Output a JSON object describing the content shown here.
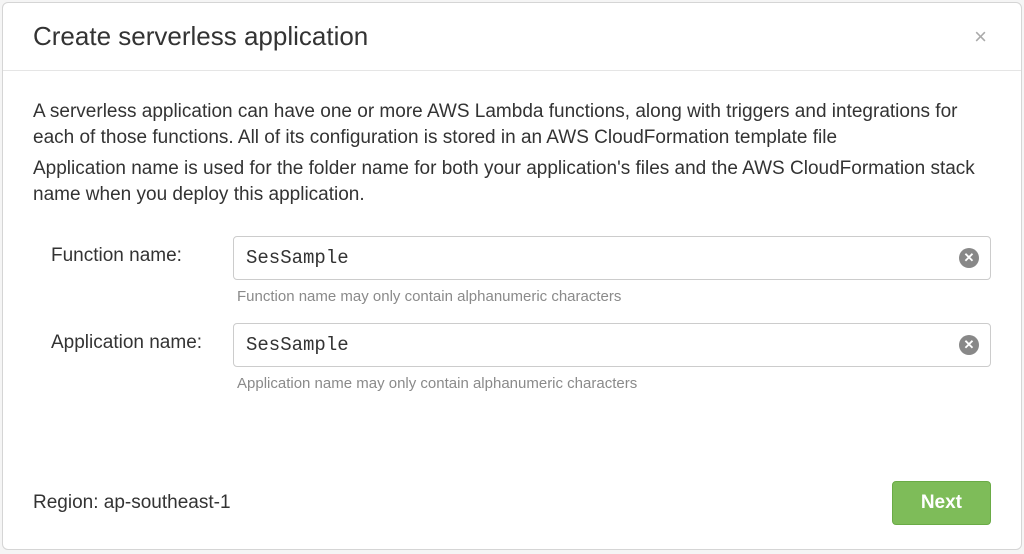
{
  "header": {
    "title": "Create serverless application"
  },
  "body": {
    "description1": "A serverless application can have one or more AWS Lambda functions, along with triggers and integrations for each of those functions. All of its configuration is stored in an AWS CloudFormation template file",
    "description2": "Application name is used for the folder name for both your application's files and the AWS CloudFormation stack name when you deploy this application.",
    "function_name": {
      "label": "Function name:",
      "value": "SesSample",
      "hint": "Function name may only contain alphanumeric characters"
    },
    "application_name": {
      "label": "Application name:",
      "value": "SesSample",
      "hint": "Application name may only contain alphanumeric characters"
    }
  },
  "footer": {
    "region_prefix": "Region: ",
    "region_value": "ap-southeast-1",
    "next_label": "Next"
  }
}
